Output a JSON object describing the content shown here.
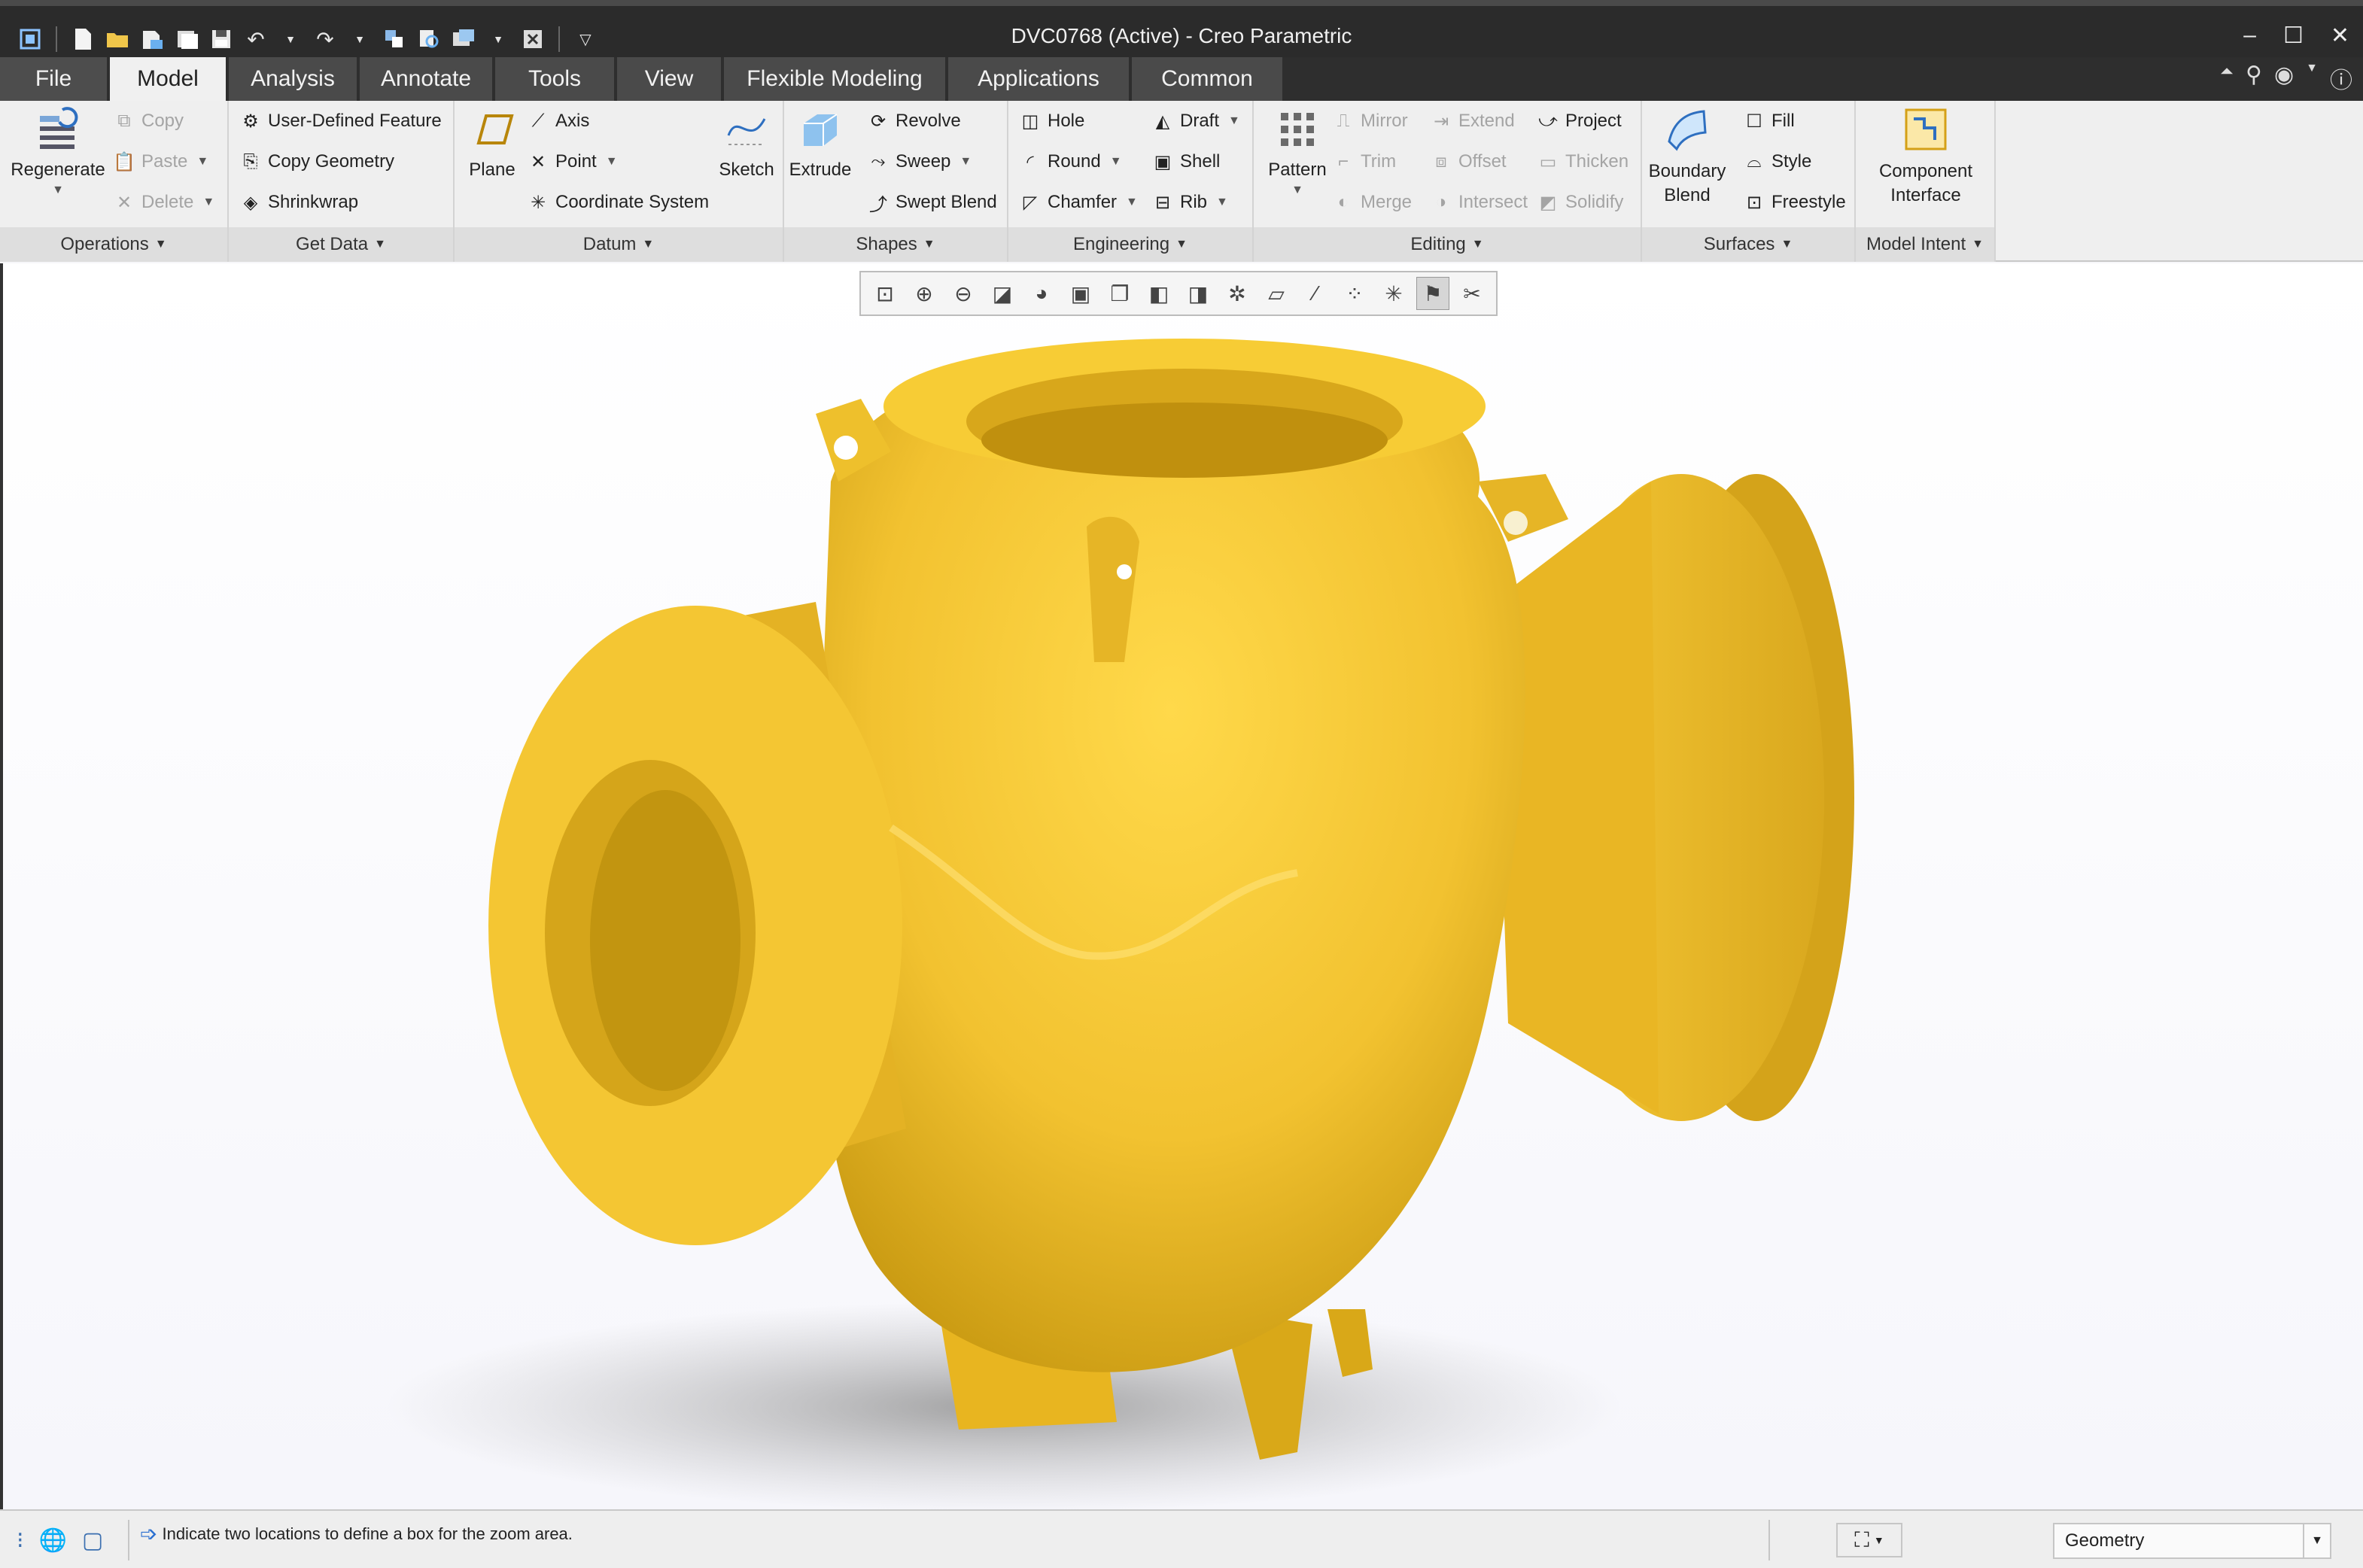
{
  "window": {
    "title": "DVC0768 (Active) - Creo Parametric",
    "controls": [
      "minimize-icon",
      "maximize-icon",
      "close-icon"
    ]
  },
  "quick_access": [
    "app-menu-icon",
    "new-file-icon",
    "open-icon",
    "open-session-icon",
    "save-copy-icon",
    "save-icon",
    "undo-icon",
    "redo-icon",
    "regenerate-icon",
    "find-icon",
    "windows-icon",
    "close-window-icon",
    "customize-icon"
  ],
  "tabs": [
    {
      "label": "File"
    },
    {
      "label": "Model"
    },
    {
      "label": "Analysis"
    },
    {
      "label": "Annotate"
    },
    {
      "label": "Tools"
    },
    {
      "label": "View"
    },
    {
      "label": "Flexible Modeling"
    },
    {
      "label": "Applications"
    },
    {
      "label": "Common"
    }
  ],
  "active_tab": "Model",
  "ribbon": {
    "operations": {
      "footer": "Operations",
      "regenerate": "Regenerate",
      "copy": "Copy",
      "paste": "Paste",
      "delete": "Delete"
    },
    "get_data": {
      "footer": "Get Data",
      "udf": "User-Defined Feature",
      "copy_geometry": "Copy Geometry",
      "shrinkwrap": "Shrinkwrap"
    },
    "datum": {
      "footer": "Datum",
      "plane": "Plane",
      "axis": "Axis",
      "point": "Point",
      "csys": "Coordinate System",
      "sketch": "Sketch"
    },
    "shapes": {
      "footer": "Shapes",
      "extrude": "Extrude",
      "revolve": "Revolve",
      "sweep": "Sweep",
      "swept_blend": "Swept Blend"
    },
    "engineering": {
      "footer": "Engineering",
      "hole": "Hole",
      "round": "Round",
      "chamfer": "Chamfer",
      "draft": "Draft",
      "shell": "Shell",
      "rib": "Rib"
    },
    "editing": {
      "footer": "Editing",
      "pattern": "Pattern",
      "mirror": "Mirror",
      "trim": "Trim",
      "merge": "Merge",
      "extend": "Extend",
      "offset": "Offset",
      "intersect": "Intersect",
      "project": "Project",
      "thicken": "Thicken",
      "solidify": "Solidify"
    },
    "surfaces": {
      "footer": "Surfaces",
      "boundary_blend_1": "Boundary",
      "boundary_blend_2": "Blend",
      "fill": "Fill",
      "style": "Style",
      "freestyle": "Freestyle"
    },
    "model_intent": {
      "footer": "Model Intent",
      "component_interface_1": "Component",
      "component_interface_2": "Interface"
    }
  },
  "view_toolbar": [
    "refit-icon",
    "zoom-in-icon",
    "zoom-out-icon",
    "repaint-icon",
    "display-style-icon",
    "saved-orientations-icon",
    "view-manager-icon",
    "perspective-icon",
    "section-icon",
    "annotation-display-icon",
    "plane-display-icon",
    "axis-display-icon",
    "point-display-icon",
    "csys-display-icon",
    "spin-center-icon",
    "annotation-icon"
  ],
  "model": {
    "name": "valve-body",
    "color": "#f2c230"
  },
  "status": {
    "message": "Indicate two locations to define a box for the zoom area.",
    "filter_value": "Geometry"
  }
}
